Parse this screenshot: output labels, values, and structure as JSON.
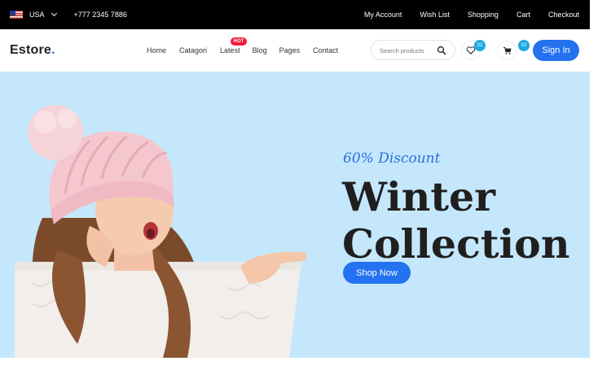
{
  "topbar": {
    "country": "USA",
    "flag_icon": "us-flag-icon",
    "phone": "+777 2345 7886",
    "links": [
      "My Account",
      "Wish List",
      "Shopping",
      "Cart",
      "Checkout"
    ]
  },
  "header": {
    "logo_text": "Estore",
    "logo_dot": ".",
    "nav": [
      "Home",
      "Catagori",
      "Latest",
      "Blog",
      "Pages",
      "Contact"
    ],
    "hot_badge": "HOT",
    "search_placeholder": "Search products",
    "wishlist_count": "02",
    "cart_count": "02",
    "signin_label": "Sign In"
  },
  "hero": {
    "discount": "60% Discount",
    "title_line1": "Winter",
    "title_line2": "Collection",
    "cta": "Shop Now"
  },
  "colors": {
    "accent": "#2472f0",
    "hero_bg": "#c5e7fb",
    "badge": "#1ea7e4",
    "hot": "#ef1b3d"
  }
}
